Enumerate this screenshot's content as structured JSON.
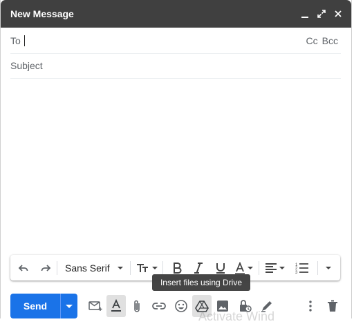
{
  "window": {
    "title": "New Message"
  },
  "fields": {
    "to_label": "To",
    "cc_label": "Cc",
    "bcc_label": "Bcc",
    "subject_placeholder": "Subject"
  },
  "toolbar": {
    "font_family": "Sans Serif",
    "icons": [
      "undo-icon",
      "redo-icon",
      "font-size-icon",
      "bold-icon",
      "italic-icon",
      "underline-icon",
      "text-color-icon",
      "align-icon",
      "numbered-list-icon",
      "more-formatting-icon"
    ]
  },
  "tooltip": {
    "text": "Insert files using Drive"
  },
  "footer": {
    "send_label": "Send",
    "icons": [
      "mail-merge-icon",
      "formatting-options-icon",
      "attach-icon",
      "link-icon",
      "emoji-icon",
      "drive-icon",
      "photo-icon",
      "confidential-icon",
      "signature-icon",
      "more-options-icon",
      "discard-icon"
    ]
  },
  "watermark": {
    "text": "Activate Wind"
  },
  "colors": {
    "header_bg": "#404040",
    "send_blue": "#1a73e8"
  }
}
